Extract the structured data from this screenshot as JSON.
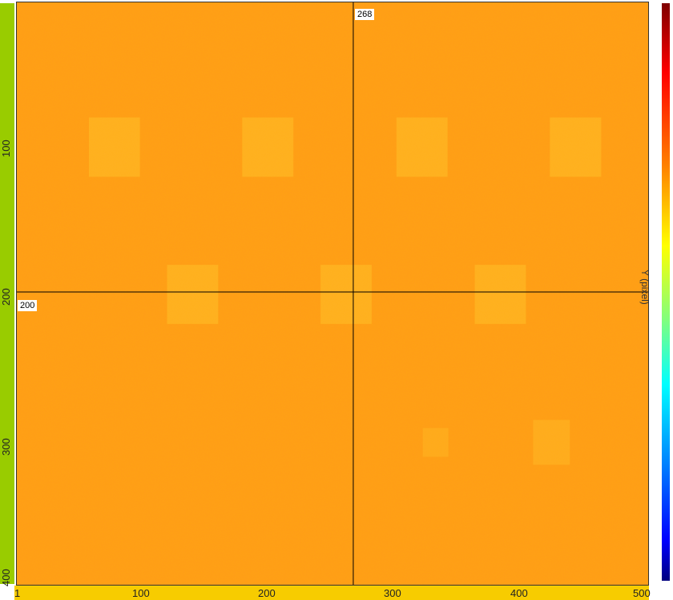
{
  "image": {
    "base_color": "#ff9c1a",
    "bright_patch_color": "#ffb82a"
  },
  "y_axis": {
    "strip_color": "#99cc00",
    "ticks": [
      "100",
      "200",
      "300",
      "400"
    ]
  },
  "x_axis": {
    "strip_color": "#f7cc00",
    "ticks": [
      "1",
      "100",
      "200",
      "300",
      "400",
      "500"
    ]
  },
  "crosshair": {
    "x_value": "268",
    "y_value": "200"
  },
  "colorbar": {
    "title": "Y (pixel)",
    "colors": [
      "#7f0000",
      "#ff0000",
      "#ff7f00",
      "#ffff00",
      "#7fff7f",
      "#00ffff",
      "#007fff",
      "#0000ff",
      "#00007f"
    ]
  }
}
